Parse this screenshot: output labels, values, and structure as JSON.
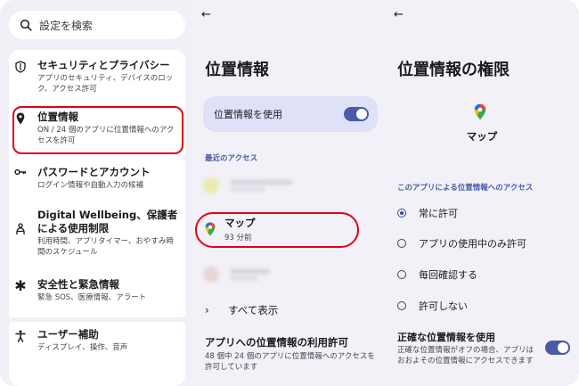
{
  "colors": {
    "accent": "#4a5aa8",
    "highlight_red": "#e2001a",
    "panel_bg": "#f1f1f7",
    "selected_bg": "#dfe1f8"
  },
  "left": {
    "search_placeholder": "設定を検索",
    "items": [
      {
        "icon": "shield-icon",
        "title": "セキュリティとプライバシー",
        "sub": "アプリのセキュリティ、デバイスのロック、アクセス許可"
      },
      {
        "icon": "location-pin-icon",
        "title": "位置情報",
        "sub": "ON / 24 個のアプリに位置情報へのアクセスを許可"
      },
      {
        "icon": "key-icon",
        "title": "パスワードとアカウント",
        "sub": "ログイン情報や自動入力の候補"
      },
      {
        "icon": "wellbeing-icon",
        "title": "Digital Wellbeing、保護者による使用制限",
        "sub": "利用時間、アプリタイマー、おやすみ時間のスケジュール"
      },
      {
        "icon": "asterisk-icon",
        "title": "安全性と緊急情報",
        "sub": "緊急 SOS、医療情報、アラート"
      },
      {
        "icon": "accessibility-icon",
        "title": "ユーザー補助",
        "sub": "ディスプレイ、操作、音声"
      }
    ]
  },
  "middle": {
    "title": "位置情報",
    "use_location_label": "位置情報を使用",
    "recent_access_label": "最近のアクセス",
    "blurred_apps": [
      {
        "name": "Snapchat",
        "time": "15 分前"
      },
      {
        "name": "Google",
        "time": "2 時間前"
      }
    ],
    "maps_app": {
      "name": "マップ",
      "time": "93 分前"
    },
    "show_all": "すべて表示",
    "perm_title": "アプリへの位置情報の利用許可",
    "perm_sub": "48 個中 24 個のアプリに位置情報へのアクセスを許可しています"
  },
  "right": {
    "title": "位置情報の権限",
    "app_name": "マップ",
    "access_label": "このアプリによる位置情報へのアクセス",
    "options": [
      {
        "label": "常に許可",
        "selected": true
      },
      {
        "label": "アプリの使用中のみ許可",
        "selected": false
      },
      {
        "label": "毎回確認する",
        "selected": false
      },
      {
        "label": "許可しない",
        "selected": false
      }
    ],
    "precise_title": "正確な位置情報を使用",
    "precise_sub": "正確な位置情報がオフの場合、アプリはおおよその位置情報にアクセスできます"
  }
}
